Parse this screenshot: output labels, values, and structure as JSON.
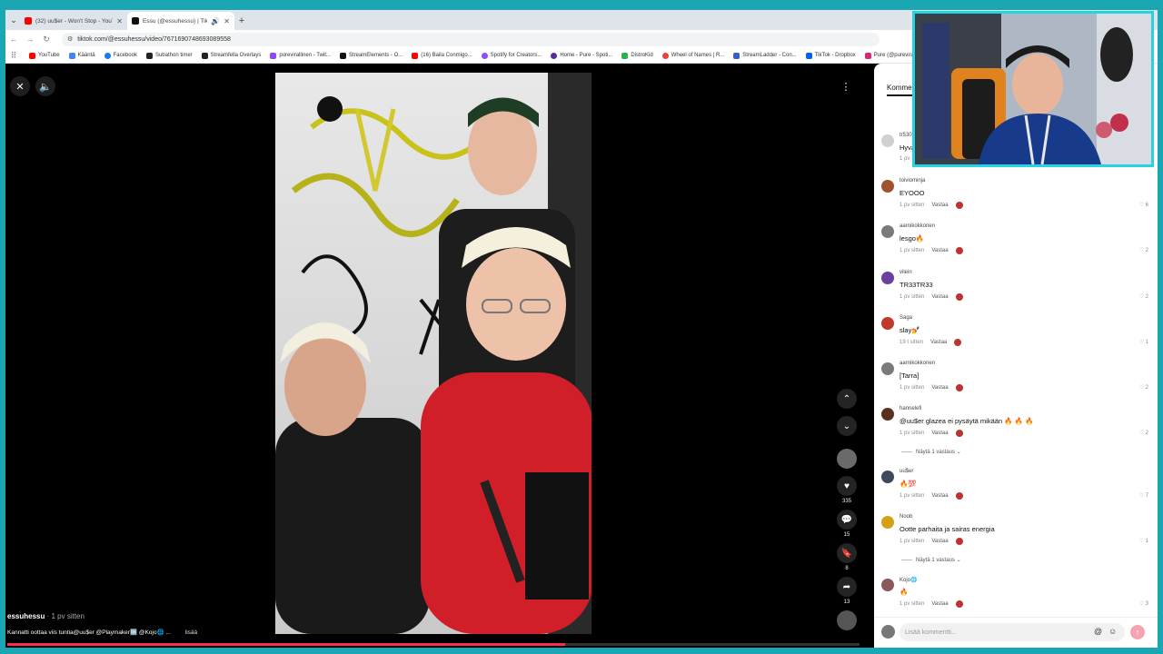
{
  "browser": {
    "tabs": [
      {
        "label": "(32) uu$er - Won't Stop - YouTu",
        "color": "#ff0000",
        "active": false
      },
      {
        "label": "Essu (@essuhessu) | TikTok",
        "color": "#111111",
        "active": true
      }
    ],
    "url": "tiktok.com/@essuhessu/video/7671690748693089558",
    "bookmarks": [
      {
        "label": "YouTube",
        "color": "#ff0000"
      },
      {
        "label": "Kääntä",
        "color": "#4285f4"
      },
      {
        "label": "Facebook",
        "color": "#1877f2"
      },
      {
        "label": "Subathon timer",
        "color": "#222222"
      },
      {
        "label": "Streamfella Overlays",
        "color": "#222222"
      },
      {
        "label": "purevirallinen - Twit...",
        "color": "#9146ff"
      },
      {
        "label": "StreamElements - O...",
        "color": "#111111"
      },
      {
        "label": "(16) Baila Conmigo...",
        "color": "#ff0000"
      },
      {
        "label": "Spotify for Creators...",
        "color": "#8a4dff"
      },
      {
        "label": "Home - Pure - Spoti...",
        "color": "#5a2aa0"
      },
      {
        "label": "DistroKid",
        "color": "#2bb34a"
      },
      {
        "label": "Wheel of Names | R...",
        "color": "#e94235"
      },
      {
        "label": "StreamLadder - Con...",
        "color": "#3b5ccc"
      },
      {
        "label": "TikTok - Dropbox",
        "color": "#0061fe"
      },
      {
        "label": "Pure (@purevirallin...",
        "color": "#d62976"
      }
    ]
  },
  "video": {
    "author": "essuhessu",
    "time": " · 1 pv sitten",
    "caption": "Kannatti oottaa viis tuntia@uu$er @Playmaker🆗 @Kojo🌐 ...",
    "more": "lisää",
    "progress": 0.655,
    "likes": "335",
    "comments": "15",
    "saves": "8",
    "shares": "13"
  },
  "comments": {
    "header": "Kommen",
    "items": [
      {
        "user": "tr530",
        "text": "Hyvä",
        "time": "1 pv",
        "reply": "",
        "likes": "",
        "color": "#d0d0d0"
      },
      {
        "user": "toiviominja",
        "text": "EYOOO",
        "time": "1 pv sitten",
        "reply": "Vastaa",
        "likes": "6",
        "color": "#a0522d"
      },
      {
        "user": "aarnikokkonen",
        "text": "lesgo🔥",
        "time": "1 pv sitten",
        "reply": "Vastaa",
        "likes": "2",
        "color": "#7a7a7a"
      },
      {
        "user": "vilein",
        "text": "TR33TR33",
        "time": "1 pv sitten",
        "reply": "Vastaa",
        "likes": "2",
        "color": "#6b3fa0"
      },
      {
        "user": "Saga",
        "text": "slay💅",
        "time": "19 t sitten",
        "reply": "Vastaa",
        "likes": "1",
        "color": "#c0392b"
      },
      {
        "user": "aarnikokkonen",
        "text": "[Tarra]",
        "time": "1 pv sitten",
        "reply": "Vastaa",
        "likes": "2",
        "color": "#7a7a7a"
      },
      {
        "user": "hannelefi",
        "text": "@uu$er glazea ei pysäytä mikään 🔥 🔥 🔥",
        "time": "1 pv sitten",
        "reply": "Vastaa",
        "likes": "2",
        "color": "#5a3020"
      },
      {
        "user": "uu$er",
        "text": "🔥💯",
        "time": "1 pv sitten",
        "reply": "Vastaa",
        "likes": "7",
        "color": "#3c4a5c"
      },
      {
        "user": "Noob",
        "text": "Oottе parhaita ja sairas energia",
        "time": "1 pv sitten",
        "reply": "Vastaa",
        "likes": "1",
        "color": "#d4a017"
      },
      {
        "user": "Kojo🌐",
        "text": "🔥",
        "time": "1 pv sitten",
        "reply": "Vastaa",
        "likes": "3",
        "color": "#8a5a5a"
      }
    ],
    "view_replies_1": "Näytä 1 vastaus ⌄",
    "view_replies_2": "Näytä 1 vastaus ⌄",
    "input_placeholder": "Lisää kommentti..."
  }
}
